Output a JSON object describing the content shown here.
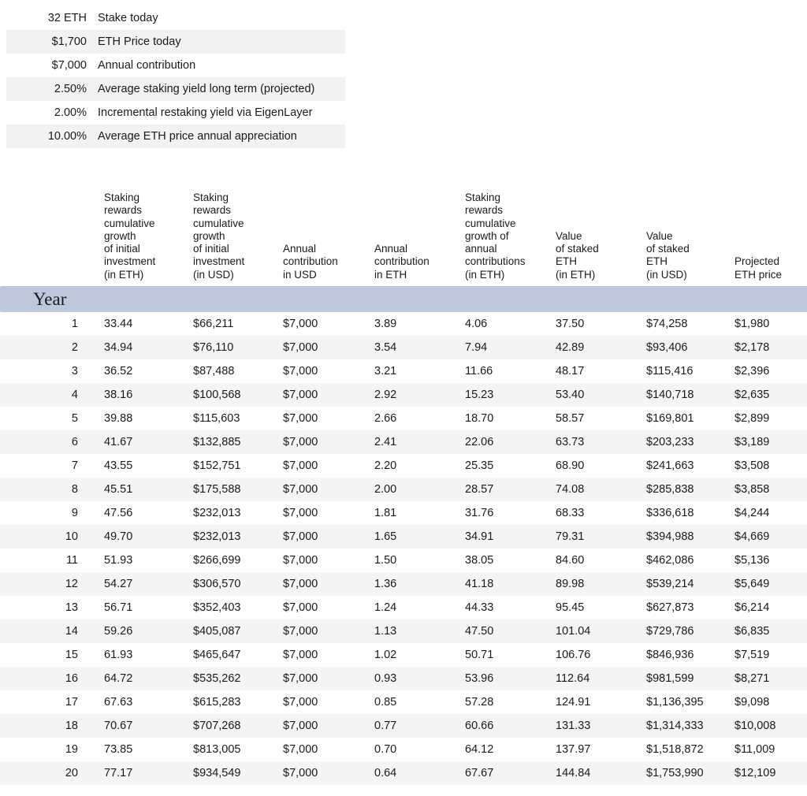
{
  "assumptions": {
    "rows": [
      {
        "value": "32 ETH",
        "label": "Stake today"
      },
      {
        "value": "$1,700",
        "label": "ETH Price today"
      },
      {
        "value": "$7,000",
        "label": "Annual contribution"
      },
      {
        "value": "2.50%",
        "label": "Average staking yield long term (projected)"
      },
      {
        "value": "2.00%",
        "label": "Incremental restaking yield via EigenLayer"
      },
      {
        "value": "10.00%",
        "label": "Average ETH price annual appreciation"
      }
    ]
  },
  "table": {
    "year_header": "Year",
    "colors": {
      "header_band": "#bdc8dd",
      "stripe": "#f4f4f4",
      "summary_stripe": "#f2f2f2",
      "text": "#1a1a1a"
    },
    "columns": [
      {
        "lines": [
          "Staking",
          "rewards",
          "cumulative",
          "growth",
          "of initial",
          "investment",
          "(in ETH)"
        ]
      },
      {
        "lines": [
          "Staking",
          "rewards",
          "cumulative",
          "growth",
          "of initial",
          "investment",
          "(in USD)"
        ]
      },
      {
        "lines": [
          "Annual",
          "contribution",
          "in USD"
        ]
      },
      {
        "lines": [
          "Annual",
          "contribution",
          "in ETH"
        ]
      },
      {
        "lines": [
          "Staking",
          "rewards",
          "cumulative",
          "growth of",
          "annual",
          "contributions",
          "(in ETH)"
        ]
      },
      {
        "lines": [
          "Value",
          "of staked",
          "ETH",
          "(in ETH)"
        ]
      },
      {
        "lines": [
          "Value",
          "of staked",
          "ETH",
          "(in USD)"
        ]
      },
      {
        "lines": [
          "Projected",
          "ETH price"
        ]
      }
    ],
    "rows": [
      {
        "year": "1",
        "cells": [
          "33.44",
          "$66,211",
          "$7,000",
          "3.89",
          "4.06",
          "37.50",
          "$74,258",
          "$1,980"
        ]
      },
      {
        "year": "2",
        "cells": [
          "34.94",
          "$76,110",
          "$7,000",
          "3.54",
          "7.94",
          "42.89",
          "$93,406",
          "$2,178"
        ]
      },
      {
        "year": "3",
        "cells": [
          "36.52",
          "$87,488",
          "$7,000",
          "3.21",
          "11.66",
          "48.17",
          "$115,416",
          "$2,396"
        ]
      },
      {
        "year": "4",
        "cells": [
          "38.16",
          "$100,568",
          "$7,000",
          "2.92",
          "15.23",
          "53.40",
          "$140,718",
          "$2,635"
        ]
      },
      {
        "year": "5",
        "cells": [
          "39.88",
          "$115,603",
          "$7,000",
          "2.66",
          "18.70",
          "58.57",
          "$169,801",
          "$2,899"
        ]
      },
      {
        "year": "6",
        "cells": [
          "41.67",
          "$132,885",
          "$7,000",
          "2.41",
          "22.06",
          "63.73",
          "$203,233",
          "$3,189"
        ]
      },
      {
        "year": "7",
        "cells": [
          "43.55",
          "$152,751",
          "$7,000",
          "2.20",
          "25.35",
          "68.90",
          "$241,663",
          "$3,508"
        ]
      },
      {
        "year": "8",
        "cells": [
          "45.51",
          "$175,588",
          "$7,000",
          "2.00",
          "28.57",
          "74.08",
          "$285,838",
          "$3,858"
        ]
      },
      {
        "year": "9",
        "cells": [
          "47.56",
          "$232,013",
          "$7,000",
          "1.81",
          "31.76",
          "68.33",
          "$336,618",
          "$4,244"
        ]
      },
      {
        "year": "10",
        "cells": [
          "49.70",
          "$232,013",
          "$7,000",
          "1.65",
          "34.91",
          "79.31",
          "$394,988",
          "$4,669"
        ]
      },
      {
        "year": "11",
        "cells": [
          "51.93",
          "$266,699",
          "$7,000",
          "1.50",
          "38.05",
          "84.60",
          "$462,086",
          "$5,136"
        ]
      },
      {
        "year": "12",
        "cells": [
          "54.27",
          "$306,570",
          "$7,000",
          "1.36",
          "41.18",
          "89.98",
          "$539,214",
          "$5,649"
        ]
      },
      {
        "year": "13",
        "cells": [
          "56.71",
          "$352,403",
          "$7,000",
          "1.24",
          "44.33",
          "95.45",
          "$627,873",
          "$6,214"
        ]
      },
      {
        "year": "14",
        "cells": [
          "59.26",
          "$405,087",
          "$7,000",
          "1.13",
          "47.50",
          "101.04",
          "$729,786",
          "$6,835"
        ]
      },
      {
        "year": "15",
        "cells": [
          "61.93",
          "$465,647",
          "$7,000",
          "1.02",
          "50.71",
          "106.76",
          "$846,936",
          "$7,519"
        ]
      },
      {
        "year": "16",
        "cells": [
          "64.72",
          "$535,262",
          "$7,000",
          "0.93",
          "53.96",
          "112.64",
          "$981,599",
          "$8,271"
        ]
      },
      {
        "year": "17",
        "cells": [
          "67.63",
          "$615,283",
          "$7,000",
          "0.85",
          "57.28",
          "124.91",
          "$1,136,395",
          "$9,098"
        ]
      },
      {
        "year": "18",
        "cells": [
          "70.67",
          "$707,268",
          "$7,000",
          "0.77",
          "60.66",
          "131.33",
          "$1,314,333",
          "$10,008"
        ]
      },
      {
        "year": "19",
        "cells": [
          "73.85",
          "$813,005",
          "$7,000",
          "0.70",
          "64.12",
          "137.97",
          "$1,518,872",
          "$11,009"
        ]
      },
      {
        "year": "20",
        "cells": [
          "77.17",
          "$934,549",
          "$7,000",
          "0.64",
          "67.67",
          "144.84",
          "$1,753,990",
          "$12,109"
        ]
      }
    ]
  }
}
